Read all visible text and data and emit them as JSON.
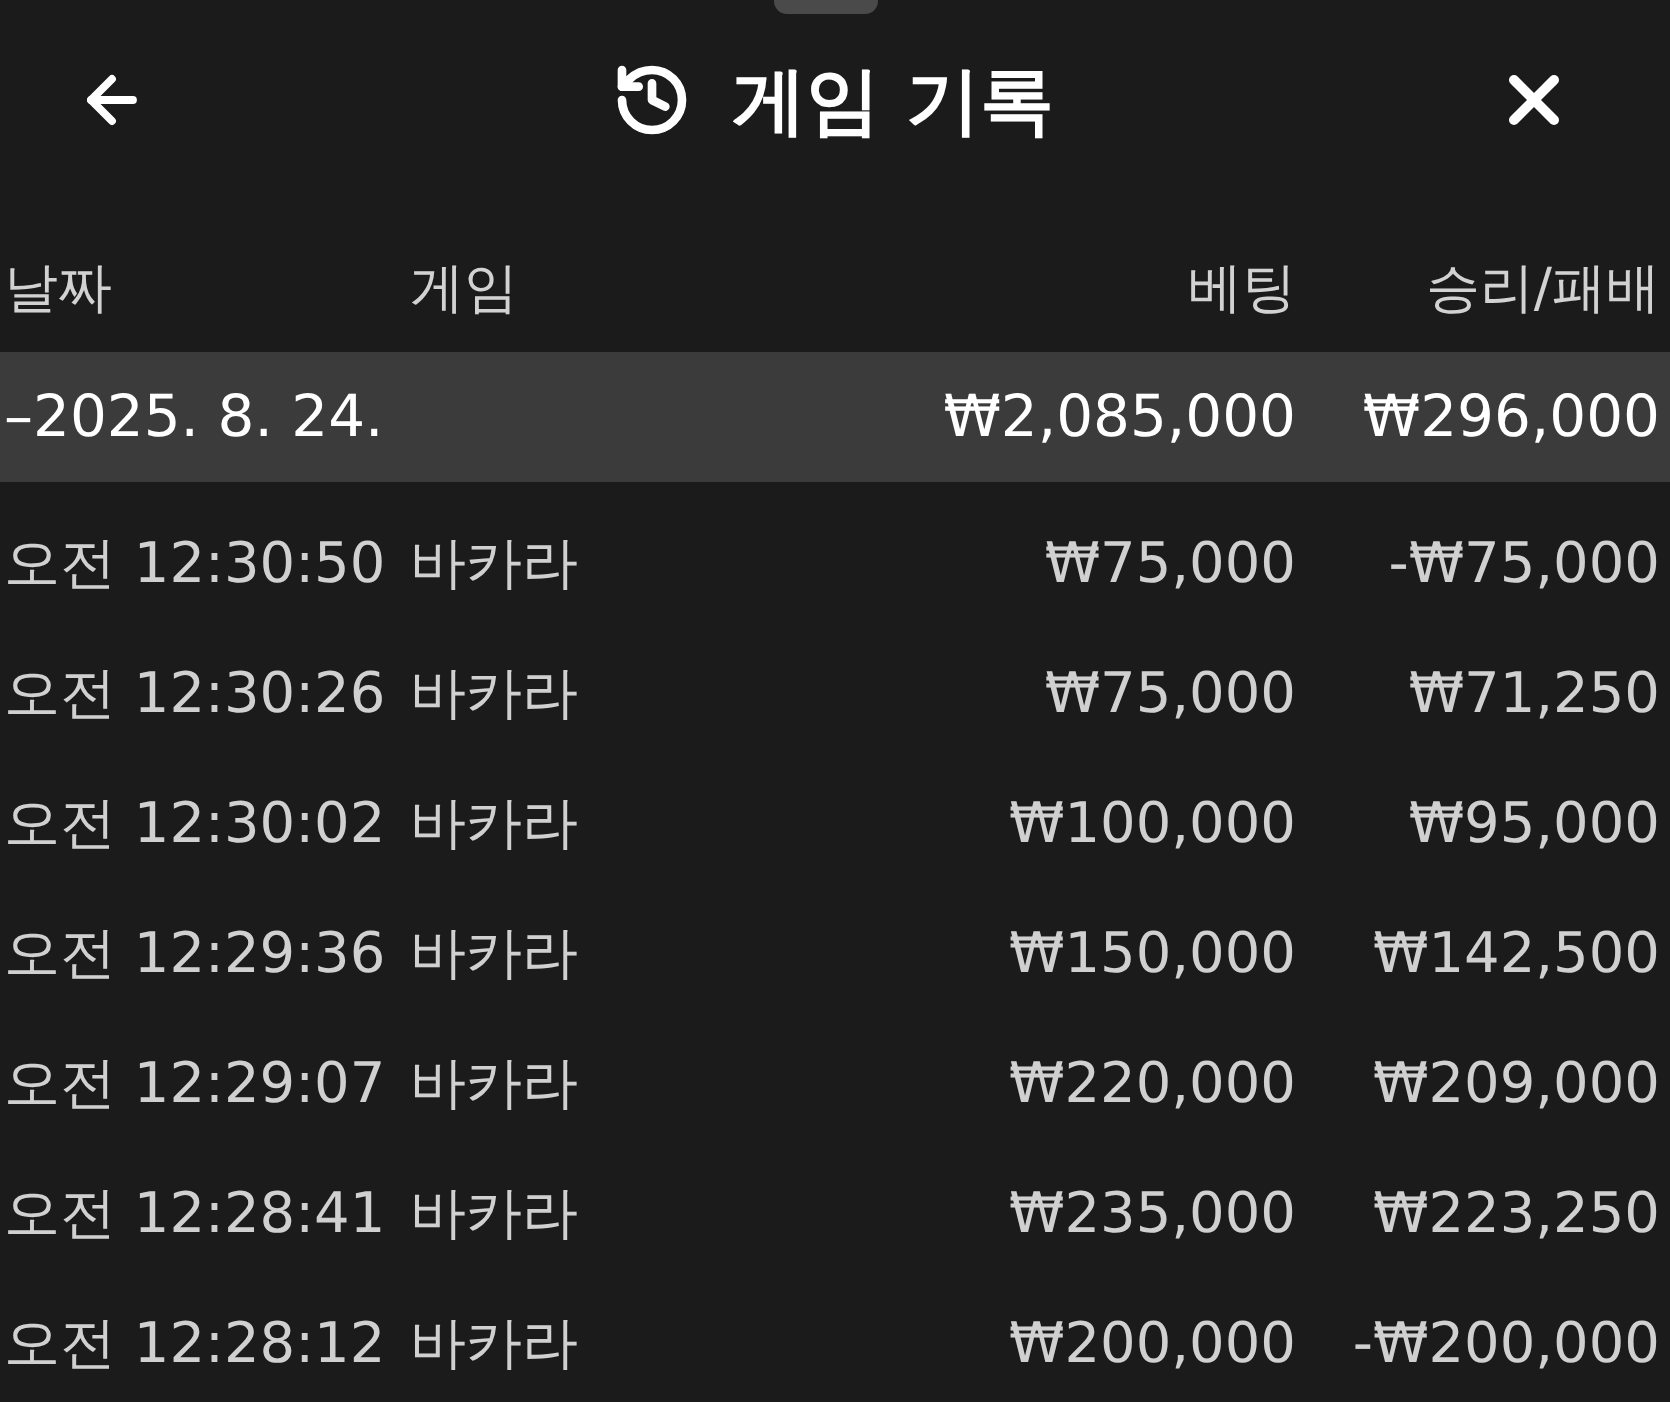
{
  "sheet": {
    "title": "게임 기록"
  },
  "columns": [
    "날짜",
    "게임",
    "베팅",
    "승리/패배"
  ],
  "groups": [
    {
      "date": "–2025. 8. 24.",
      "bet_total": "₩2,085,000",
      "result_total": "₩296,000",
      "rows": [
        {
          "time": "오전 12:30:50",
          "game": "바카라",
          "bet": "₩75,000",
          "result": "-₩75,000"
        },
        {
          "time": "오전 12:30:26",
          "game": "바카라",
          "bet": "₩75,000",
          "result": "₩71,250"
        },
        {
          "time": "오전 12:30:02",
          "game": "바카라",
          "bet": "₩100,000",
          "result": "₩95,000"
        },
        {
          "time": "오전 12:29:36",
          "game": "바카라",
          "bet": "₩150,000",
          "result": "₩142,500"
        },
        {
          "time": "오전 12:29:07",
          "game": "바카라",
          "bet": "₩220,000",
          "result": "₩209,000"
        },
        {
          "time": "오전 12:28:41",
          "game": "바카라",
          "bet": "₩235,000",
          "result": "₩223,250"
        },
        {
          "time": "오전 12:28:12",
          "game": "바카라",
          "bet": "₩200,000",
          "result": "-₩200,000"
        }
      ]
    }
  ]
}
